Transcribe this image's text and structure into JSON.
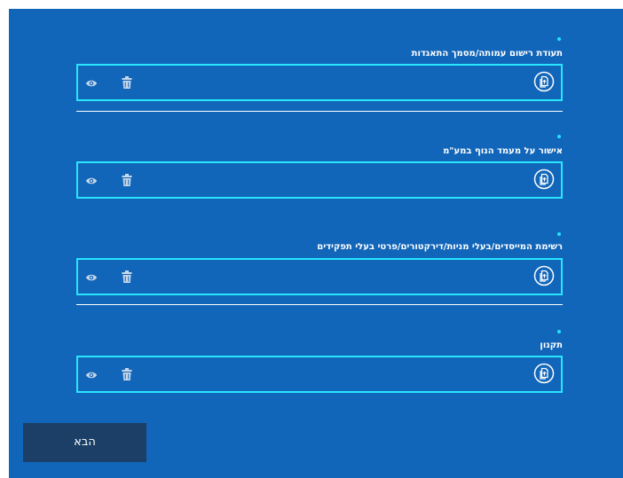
{
  "documents": [
    {
      "title": "תעודת רישום עמותה/מסמך התאגדות"
    },
    {
      "title": "אישור על מעמד הנוף במע\"מ"
    },
    {
      "title": "רשימת המייסדים/בעלי מניות/דירקטורים/פרטי בעלי תפקידים"
    },
    {
      "title": "תקנון"
    }
  ],
  "actions": {
    "next_label": "הבא"
  },
  "icons": {
    "view": "eye-icon",
    "delete": "trash-icon",
    "upload": "upload-icon"
  },
  "colors": {
    "panel_background": "#1266b9",
    "box_border": "#28e6ff",
    "next_button_background": "#1b3f66",
    "text": "#ffffff"
  }
}
